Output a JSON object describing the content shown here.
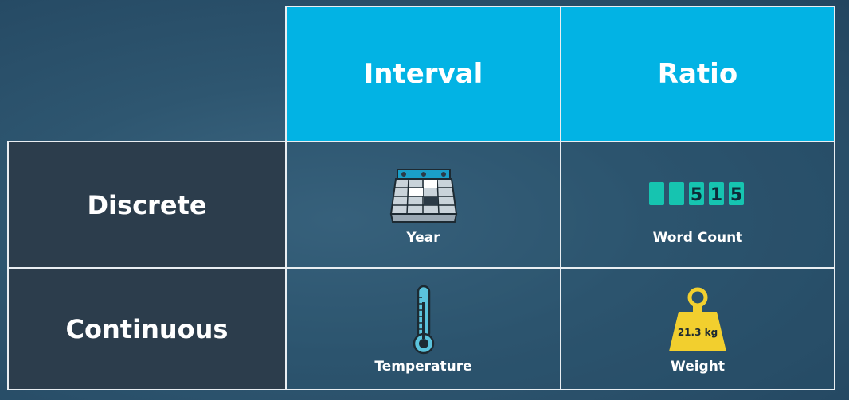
{
  "table": {
    "columns": [
      "Interval",
      "Ratio"
    ],
    "rows": [
      {
        "label": "Discrete",
        "cells": [
          {
            "caption": "Year",
            "icon": "calendar-icon"
          },
          {
            "caption": "Word Count",
            "icon": "counter-icon",
            "counter_digits": [
              "",
              "",
              "5",
              "1",
              "5"
            ]
          }
        ]
      },
      {
        "label": "Continuous",
        "cells": [
          {
            "caption": "Temperature",
            "icon": "thermometer-icon"
          },
          {
            "caption": "Weight",
            "icon": "weight-icon",
            "weight_label": "21.3 kg"
          }
        ]
      }
    ]
  },
  "colors": {
    "header_bg": "#02b3e4",
    "row_header_bg": "#2c3d4c",
    "grid_line": "#e9eef2",
    "counter_teal": "#16c4b0",
    "weight_yellow": "#f2cf2e"
  }
}
